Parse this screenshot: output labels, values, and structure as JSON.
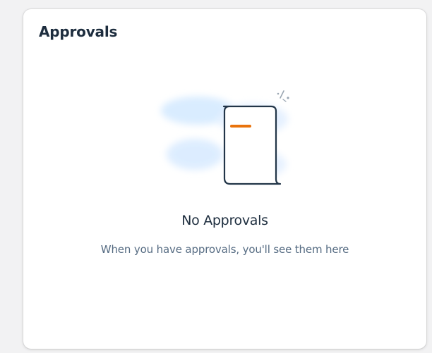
{
  "card": {
    "title": "Approvals"
  },
  "empty_state": {
    "illustration_icon": "empty-document-icon",
    "title": "No Approvals",
    "subtitle": "When you have approvals, you'll see them here"
  },
  "colors": {
    "page_background": "#f2f2f3",
    "card_background": "#ffffff",
    "title_text": "#1d2d3e",
    "subtitle_text": "#556b82",
    "accent_orange": "#e9730c",
    "illustration_blue": "#e2efff",
    "illustration_stroke": "#223548"
  }
}
